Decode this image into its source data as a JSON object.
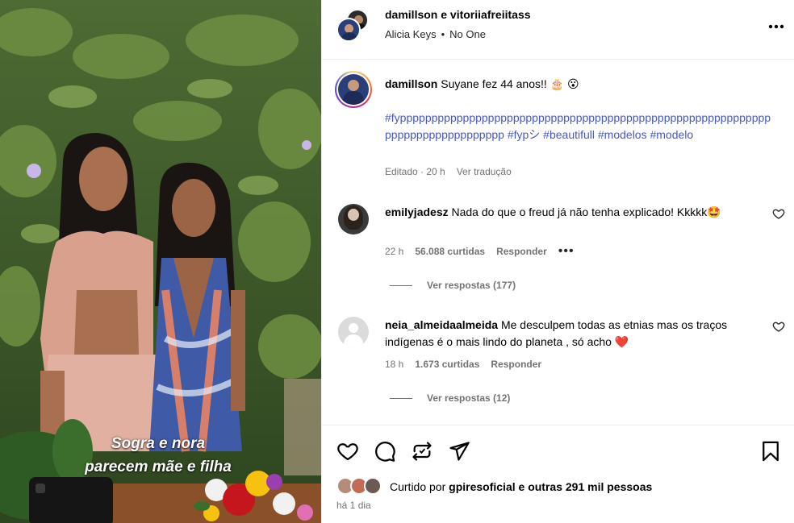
{
  "photo": {
    "caption_line1": "Sogra e nora",
    "caption_line2": "parecem mãe e filha"
  },
  "header": {
    "users": "damillson e vitoriiafreiitass",
    "music_artist": "Alicia Keys",
    "music_separator": "•",
    "music_track": "No One",
    "more_icon": "more-horizontal-icon"
  },
  "caption": {
    "username": "damillson",
    "text": "Suyane fez 44 anos!! 🎂 😮",
    "hashtags": "#fypppppppppppppppppppppppppppppppppppppppppppppppppppppppppppppppppppppppppppppp #fypシ #beautifull #modelos #modelo",
    "edited": "Editado · 20 h",
    "translate": "Ver tradução"
  },
  "comments": [
    {
      "username": "emilyjadesz",
      "text": "Nada do que o freud já não tenha explicado! Kkkkk🤩",
      "time": "22 h",
      "likes": "56.088 curtidas",
      "reply": "Responder",
      "more": "•••",
      "view_replies": "Ver respostas (177)"
    },
    {
      "username": "neia_almeidaalmeida",
      "text": "Me desculpem todas as etnias mas os traços indígenas é o mais lindo do planeta , só acho ❤️",
      "time": "18 h",
      "likes": "1.673 curtidas",
      "reply": "Responder",
      "view_replies": "Ver respostas (12)"
    }
  ],
  "actions": {
    "liked_prefix": "Curtido por",
    "liked_user": "gpiresoficial",
    "liked_suffix": "e outras 291 mil pessoas",
    "date": "há 1 dia"
  },
  "colors": {
    "hashtag": "#4558c8",
    "muted": "#737373",
    "heart_red": "#ed4956"
  }
}
